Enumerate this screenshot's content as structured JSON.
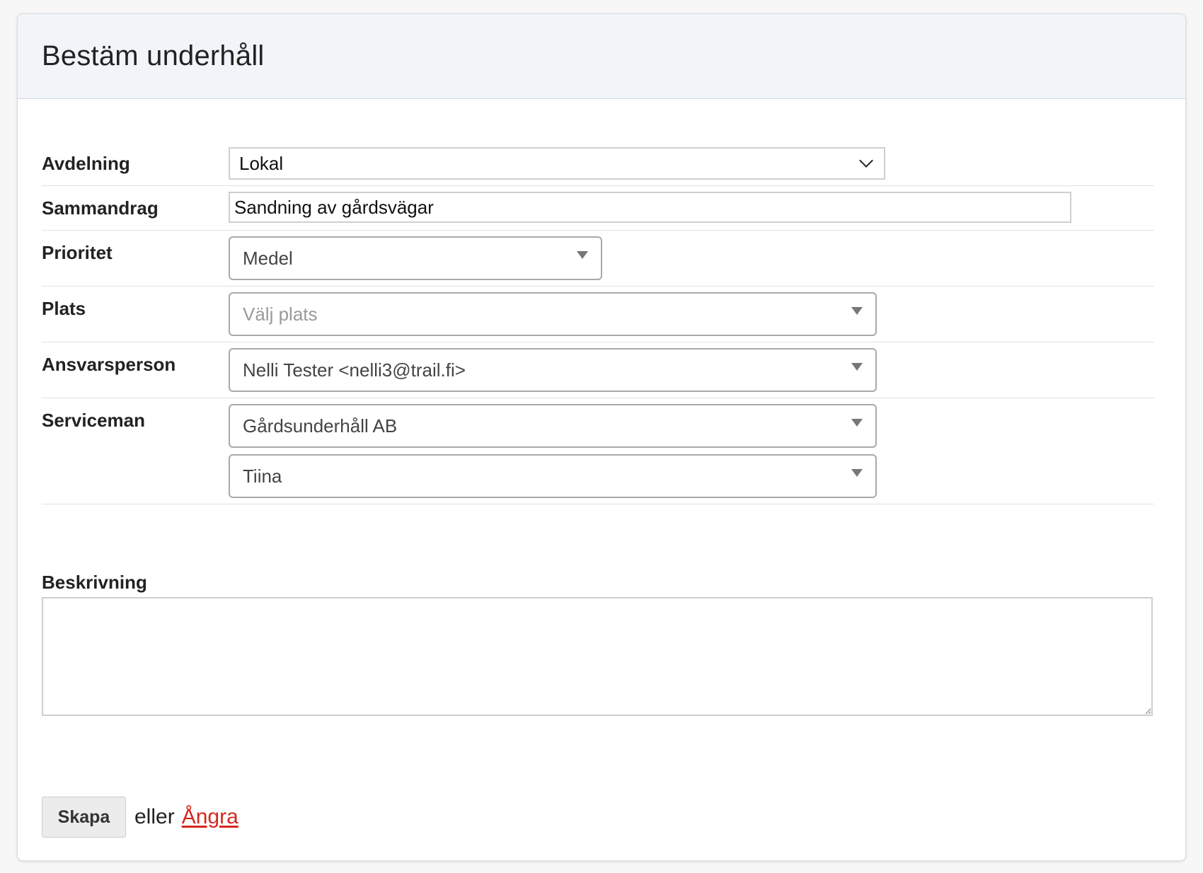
{
  "panel": {
    "title": "Bestäm underhåll"
  },
  "form": {
    "department": {
      "label": "Avdelning",
      "value": "Lokal"
    },
    "summary": {
      "label": "Sammandrag",
      "value": "Sandning av gårdsvägar"
    },
    "priority": {
      "label": "Prioritet",
      "value": "Medel"
    },
    "location": {
      "label": "Plats",
      "placeholder": "Välj plats"
    },
    "responsible": {
      "label": "Ansvarsperson",
      "value": "Nelli Tester <nelli3@trail.fi>"
    },
    "serviceman": {
      "label": "Serviceman",
      "company": "Gårdsunderhåll AB",
      "person": "Tiina"
    },
    "description": {
      "label": "Beskrivning",
      "value": ""
    }
  },
  "actions": {
    "create_label": "Skapa",
    "or_text": "eller",
    "cancel_label": "Ångra"
  },
  "colors": {
    "header_bg": "#f1f5f9",
    "cancel_link": "#d6281f"
  },
  "icons": {
    "department_select": "chevron-down-icon",
    "chosen_selects": "caret-down-icon"
  }
}
